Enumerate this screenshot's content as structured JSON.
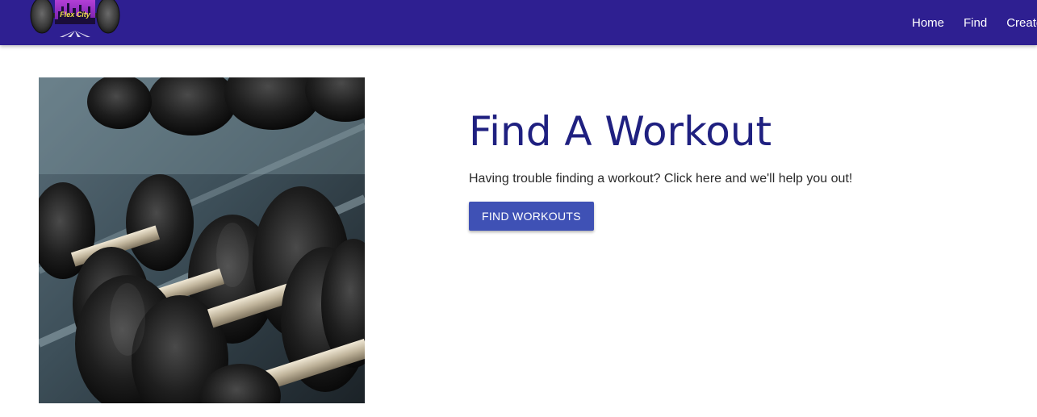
{
  "header": {
    "logo_text": "Flex City",
    "nav": [
      {
        "label": "Home"
      },
      {
        "label": "Find"
      },
      {
        "label": "Create"
      }
    ]
  },
  "main": {
    "title": "Find A Workout",
    "description": "Having trouble finding a workout? Click here and we'll help you out!",
    "button_label": "FIND WORKOUTS"
  },
  "colors": {
    "navbar": "#2e1f91",
    "title": "#1f2080",
    "button": "#3f51b5"
  }
}
